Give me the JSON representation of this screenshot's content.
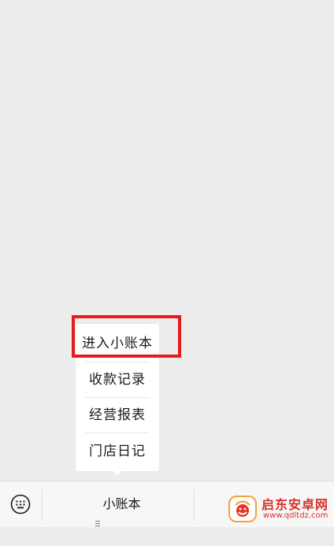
{
  "popup_menu": {
    "items": [
      {
        "label": "进入小账本"
      },
      {
        "label": "收款记录"
      },
      {
        "label": "经营报表"
      },
      {
        "label": "门店日记"
      }
    ]
  },
  "bottom_bar": {
    "keyboard_icon": "keyboard-icon",
    "tab_label": "小账本",
    "tab_icon": "menu-lines-icon"
  },
  "watermark": {
    "text": "启东安卓网",
    "url": "www.qdltdz.com",
    "logo_icon": "qidong-logo"
  },
  "colors": {
    "highlight": "#e81a1a",
    "background": "#ededed",
    "watermark": "#d9302a"
  }
}
